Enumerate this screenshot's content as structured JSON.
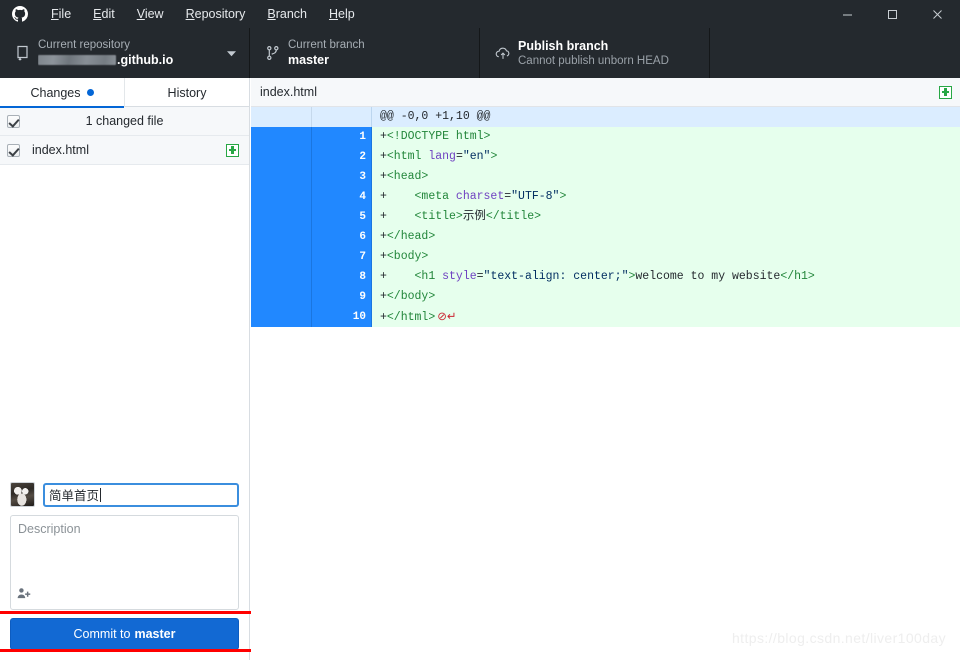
{
  "window": {
    "menu": [
      {
        "label": "File",
        "accel": "F"
      },
      {
        "label": "Edit",
        "accel": "E"
      },
      {
        "label": "View",
        "accel": "V"
      },
      {
        "label": "Repository",
        "accel": "R"
      },
      {
        "label": "Branch",
        "accel": "B"
      },
      {
        "label": "Help",
        "accel": "H"
      }
    ],
    "controls": {
      "minimize": "minimize-icon",
      "maximize": "maximize-icon",
      "close": "close-icon"
    },
    "logo": "github-logo-icon"
  },
  "toolbar": {
    "repository": {
      "label": "Current repository",
      "value_suffix": ".github.io",
      "value_redacted": true,
      "icon": "repo-icon",
      "caret": "chevron-down-icon"
    },
    "branch": {
      "label": "Current branch",
      "value": "master",
      "icon": "branch-icon"
    },
    "publish": {
      "label": "Publish branch",
      "sub": "Cannot publish unborn HEAD",
      "icon": "cloud-upload-icon"
    }
  },
  "sidebar": {
    "tabs": [
      {
        "label": "Changes",
        "active": true,
        "badge": "dot"
      },
      {
        "label": "History",
        "active": false,
        "badge": ""
      }
    ],
    "changed_summary": "1 changed file",
    "files": [
      {
        "name": "index.html",
        "status": "added",
        "checked": true
      }
    ]
  },
  "commit": {
    "summary_value": "简单首页",
    "description_placeholder": "Description",
    "coauthor_icon": "add-person-icon",
    "button_prefix": "Commit to",
    "button_branch": "master",
    "avatar": "user-avatar"
  },
  "diff": {
    "filename": "index.html",
    "status_icon": "added-plus-icon",
    "hunk_header": "@@ -0,0 +1,10 @@",
    "lines": [
      {
        "num": "1",
        "prefix": "+",
        "tokens": [
          {
            "t": "<!DOCTYPE html>",
            "c": "tag"
          }
        ]
      },
      {
        "num": "2",
        "prefix": "+",
        "tokens": [
          {
            "t": "<html ",
            "c": "tag"
          },
          {
            "t": "lang",
            "c": "attr"
          },
          {
            "t": "=",
            "c": "txt"
          },
          {
            "t": "\"en\"",
            "c": "str"
          },
          {
            "t": ">",
            "c": "tag"
          }
        ]
      },
      {
        "num": "3",
        "prefix": "+",
        "tokens": [
          {
            "t": "<head>",
            "c": "tag"
          }
        ]
      },
      {
        "num": "4",
        "prefix": "+",
        "tokens": [
          {
            "t": "    <meta ",
            "c": "tag"
          },
          {
            "t": "charset",
            "c": "attr"
          },
          {
            "t": "=",
            "c": "txt"
          },
          {
            "t": "\"UTF-8\"",
            "c": "str"
          },
          {
            "t": ">",
            "c": "tag"
          }
        ]
      },
      {
        "num": "5",
        "prefix": "+",
        "tokens": [
          {
            "t": "    <title>",
            "c": "tag"
          },
          {
            "t": "示例",
            "c": "txt"
          },
          {
            "t": "</title>",
            "c": "tag"
          }
        ]
      },
      {
        "num": "6",
        "prefix": "+",
        "tokens": [
          {
            "t": "</head>",
            "c": "tag"
          }
        ]
      },
      {
        "num": "7",
        "prefix": "+",
        "tokens": [
          {
            "t": "<body>",
            "c": "tag"
          }
        ]
      },
      {
        "num": "8",
        "prefix": "+",
        "tokens": [
          {
            "t": "    <h1 ",
            "c": "tag"
          },
          {
            "t": "style",
            "c": "attr"
          },
          {
            "t": "=",
            "c": "txt"
          },
          {
            "t": "\"text-align: center;\"",
            "c": "str"
          },
          {
            "t": ">",
            "c": "tag"
          },
          {
            "t": "welcome to my website",
            "c": "txt"
          },
          {
            "t": "</h1>",
            "c": "tag"
          }
        ]
      },
      {
        "num": "9",
        "prefix": "+",
        "tokens": [
          {
            "t": "</body>",
            "c": "tag"
          }
        ]
      },
      {
        "num": "10",
        "prefix": "+",
        "tokens": [
          {
            "t": "</html>",
            "c": "tag"
          }
        ],
        "no_newline": true
      }
    ]
  },
  "watermark": "https://blog.csdn.net/liver100day",
  "colors": {
    "chrome_dark": "#24292e",
    "accent_blue": "#0366d6",
    "commit_blue": "#1269d3",
    "diff_add_bg": "#e6ffed",
    "diff_gutter_blue": "#2188ff",
    "hunk_bg": "#dbedff",
    "added_green": "#28a745",
    "annotation_red": "#ff0000"
  }
}
